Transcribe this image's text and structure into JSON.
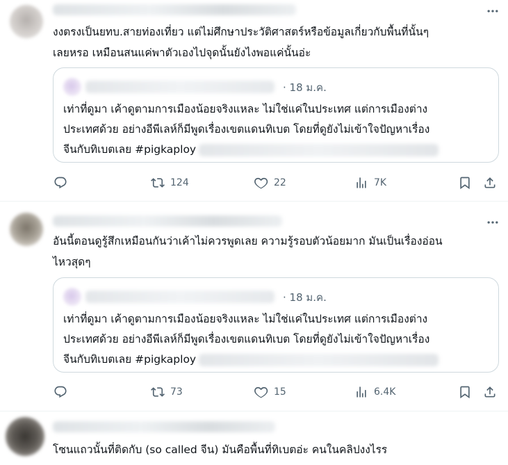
{
  "tweets": [
    {
      "text_lines": [
        "งงตรงเป็นยทบ.สายท่องเที่ยว แต่ไม่ศึกษาประวัติศาสตร์หรือข้อมูลเกี่ยวกับพื้นที่นั้นๆ",
        "เลยหรอ เหมือนสนแค่พาตัวเองไปจุดนั้นยังไงพอแค่นั้นอ่ะ"
      ],
      "quote": {
        "date": "· 18 ม.ค.",
        "text_lines": [
          "เท่าที่ดูมา เค้าดูตามการเมืองน้อยจริงแหละ ไม่ใช่แค่ในประเทศ แต่การเมืองต่าง",
          "ประเทศด้วย อย่างอีพีเลห์ก็มีพูดเรื่องเขตแดนทิเบต โดยที่ดูยังไม่เข้าใจปัญหาเรื่อง",
          "จีนกับทิเบตเลย #pigkaploy"
        ]
      },
      "stats": {
        "replies": "",
        "retweets": "124",
        "likes": "22",
        "views": "7K"
      }
    },
    {
      "text_lines": [
        "อันนี้ตอนดูรู้สึกเหมือนกันว่าเค้าไม่ควรพูดเลย ความรู้รอบตัวน้อยมาก มันเป็นเรื่องอ่อน",
        "ไหวสุดๆ"
      ],
      "quote": {
        "date": "· 18 ม.ค.",
        "text_lines": [
          "เท่าที่ดูมา เค้าดูตามการเมืองน้อยจริงแหละ ไม่ใช่แค่ในประเทศ แต่การเมืองต่าง",
          "ประเทศด้วย อย่างอีพีเลห์ก็มีพูดเรื่องเขตแดนทิเบต โดยที่ดูยังไม่เข้าใจปัญหาเรื่อง",
          "จีนกับทิเบตเลย #pigkaploy"
        ]
      },
      "stats": {
        "replies": "",
        "retweets": "73",
        "likes": "15",
        "views": "6.4K"
      }
    },
    {
      "text_lines": [
        "โซนแถวนั้นที่ติดกับ (so called จีน) มันคือพื้นที่ทิเบตอ่ะ คนในคลิปงงไรร"
      ]
    }
  ],
  "icons": {
    "more": "more-horizontal-icon",
    "reply": "reply-icon",
    "retweet": "retweet-icon",
    "like": "heart-icon",
    "views": "analytics-icon",
    "bookmark": "bookmark-icon",
    "share": "share-icon"
  },
  "colors": {
    "text": "#0f1419",
    "secondary": "#536471",
    "border": "#cfd9de",
    "divider": "#eff3f4"
  }
}
